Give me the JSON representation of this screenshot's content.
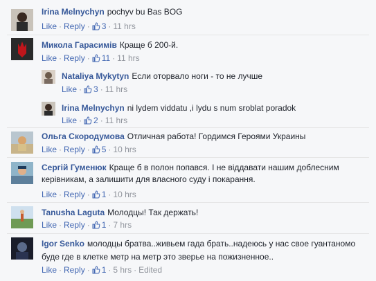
{
  "comments": [
    {
      "author": "Irina Melnychyn",
      "text": "pochyv bu Bas BOG",
      "like": "Like",
      "reply": "Reply",
      "likes": "3",
      "time": "11 hrs",
      "edited": ""
    },
    {
      "author": "Микола Гарасимів",
      "text": "Краще б 200-й.",
      "like": "Like",
      "reply": "Reply",
      "likes": "11",
      "time": "11 hrs",
      "edited": ""
    },
    {
      "author": "Nataliya Mykytyn",
      "text": "Если оторвало ноги - то не лучше",
      "like": "Like",
      "reply": "",
      "likes": "3",
      "time": "11 hrs",
      "edited": ""
    },
    {
      "author": "Irina Melnychyn",
      "text": "ni lydem viddatu ,i lydu s num sroblat poradok",
      "like": "Like",
      "reply": "",
      "likes": "2",
      "time": "11 hrs",
      "edited": ""
    },
    {
      "author": "Ольга Скородумова",
      "text": "Отличная работа! Гордимся Героями Украины",
      "like": "Like",
      "reply": "Reply",
      "likes": "5",
      "time": "10 hrs",
      "edited": ""
    },
    {
      "author": "Сергій Гуменюк",
      "text": "Краще б в полон попався. І не віддавати нашим доблесним керівникам, а залишити для власного суду і покарання.",
      "like": "Like",
      "reply": "Reply",
      "likes": "1",
      "time": "10 hrs",
      "edited": ""
    },
    {
      "author": "Tanusha Laguta",
      "text": "Молодцы! Так держать!",
      "like": "Like",
      "reply": "Reply",
      "likes": "1",
      "time": "7 hrs",
      "edited": ""
    },
    {
      "author": "Igor Senko",
      "text": "молодцы братва..живьем гада брать..надеюсь у нас свое гуантаномо буде где в клетке метр на метр это зверье на пожизненное..",
      "like": "Like",
      "reply": "Reply",
      "likes": "1",
      "time": "5 hrs",
      "edited": "Edited"
    }
  ],
  "colors": {
    "link": "#4267b2",
    "author": "#365899",
    "meta": "#90949c",
    "background": "#f6f7f9"
  }
}
